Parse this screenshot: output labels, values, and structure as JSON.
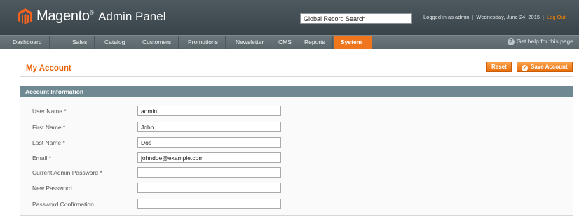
{
  "header": {
    "brand_name": "Magento",
    "brand_tm": "®",
    "brand_sub": "Admin Panel",
    "search_value": "Global Record Search",
    "logged_in": "Logged in as admin",
    "date": "Wednesday, June 24, 2015",
    "logout": "Log Out",
    "logo_icon": "magento-logo-icon",
    "logo_color": "#f26322"
  },
  "nav": {
    "items": [
      {
        "label": "Dashboard"
      },
      {
        "label": "Sales"
      },
      {
        "label": "Catalog"
      },
      {
        "label": "Customers"
      },
      {
        "label": "Promotions"
      },
      {
        "label": "Newsletter"
      },
      {
        "label": "CMS"
      },
      {
        "label": "Reports"
      },
      {
        "label": "System"
      }
    ],
    "active": "System",
    "help": "Get help for this page",
    "accent": "#f0761e"
  },
  "page": {
    "title": "My Account",
    "reset_label": "Reset",
    "save_label": "Save Account"
  },
  "fieldset": {
    "title": "Account Information",
    "fields": [
      {
        "label": "User Name *",
        "value": "admin"
      },
      {
        "label": "First Name *",
        "value": "John"
      },
      {
        "label": "Last Name *",
        "value": "Doe"
      },
      {
        "label": "Email *",
        "value": "johndoe@example.com"
      },
      {
        "label": "Current Admin Password *",
        "value": ""
      },
      {
        "label": "New Password",
        "value": ""
      },
      {
        "label": "Password Confirmation",
        "value": ""
      }
    ]
  }
}
